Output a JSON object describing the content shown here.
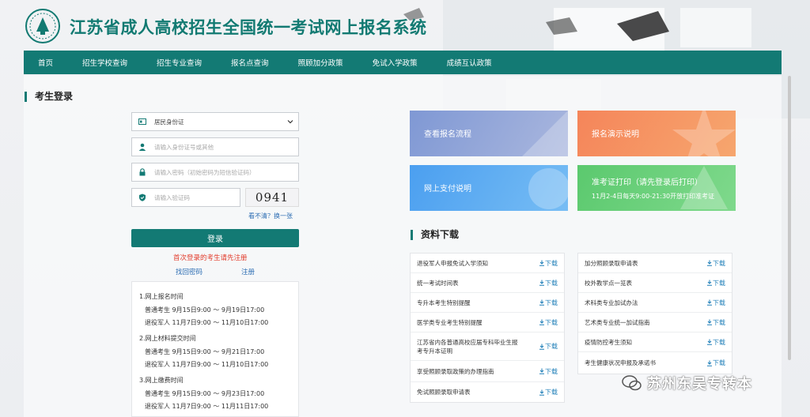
{
  "header": {
    "title": "江苏省成人高校招生全国统一考试网上报名系统"
  },
  "nav": {
    "items": [
      "首页",
      "招生学校查询",
      "招生专业查询",
      "报名点查询",
      "照顾加分政策",
      "免试入学政策",
      "成绩互认政策"
    ]
  },
  "login": {
    "section_title": "考生登录",
    "id_type": "居民身份证",
    "id_placeholder": "请输入身份证号或其他",
    "password_placeholder": "请输入密码（初始密码为短信验证码）",
    "captcha_placeholder": "请输入验证码",
    "captcha_text": "0941",
    "refresh": "看不清？换一张",
    "login_button": "登录",
    "first_login": "首次登录的考生请先注册",
    "forgot": "找回密码",
    "register": "注册"
  },
  "notice": [
    {
      "title": "1.网上报名时间",
      "lines": [
        "普通考生 9月15日9:00 ～ 9月19日17:00",
        "退役军人 11月7日9:00 ～ 11月10日17:00"
      ]
    },
    {
      "title": "2.网上材料提交时间",
      "lines": [
        "普通考生 9月15日9:00 ～ 9月21日17:00",
        "退役军人 11月7日9:00 ～ 11月10日17:00"
      ]
    },
    {
      "title": "3.网上缴费时间",
      "lines": [
        "普通考生 9月15日9:00 ～ 9月23日17:00",
        "退役军人 11月7日9:00 ～ 11月11日17:00"
      ]
    }
  ],
  "tiles": [
    {
      "label": "查看报名流程",
      "sub": ""
    },
    {
      "label": "报名演示说明",
      "sub": ""
    },
    {
      "label": "网上支付说明",
      "sub": ""
    },
    {
      "label": "准考证打印（请先登录后打印）",
      "sub": "11月2-4日每天9:00-21:30开放打印准考证"
    }
  ],
  "downloads": {
    "section_title": "资料下载",
    "download_label": "下载",
    "left": [
      "退役军人申报免试入学须知",
      "统一考试时间表",
      "专升本考生特别提醒",
      "医学类专业考生特别提醒",
      "江苏省内各普通高校应届专科毕业生报考专升本证明",
      "享受照顾录取政策的办理指南",
      "免试照顾录取申请表"
    ],
    "right": [
      "加分照顾录取申请表",
      "校外教学点一览表",
      "术科类专业加试办法",
      "艺术类专业统一加试指南",
      "疫情防控考生须知",
      "考生健康状况申报及承诺书"
    ]
  },
  "watermark": "苏州东吴专转本",
  "colors": {
    "brand": "#137a74",
    "tile_blue": "#8fa4d6",
    "tile_orange": "#f49462",
    "tile_sky": "#5aa9f0",
    "tile_green": "#66cf79",
    "alert": "#e23b2a"
  }
}
